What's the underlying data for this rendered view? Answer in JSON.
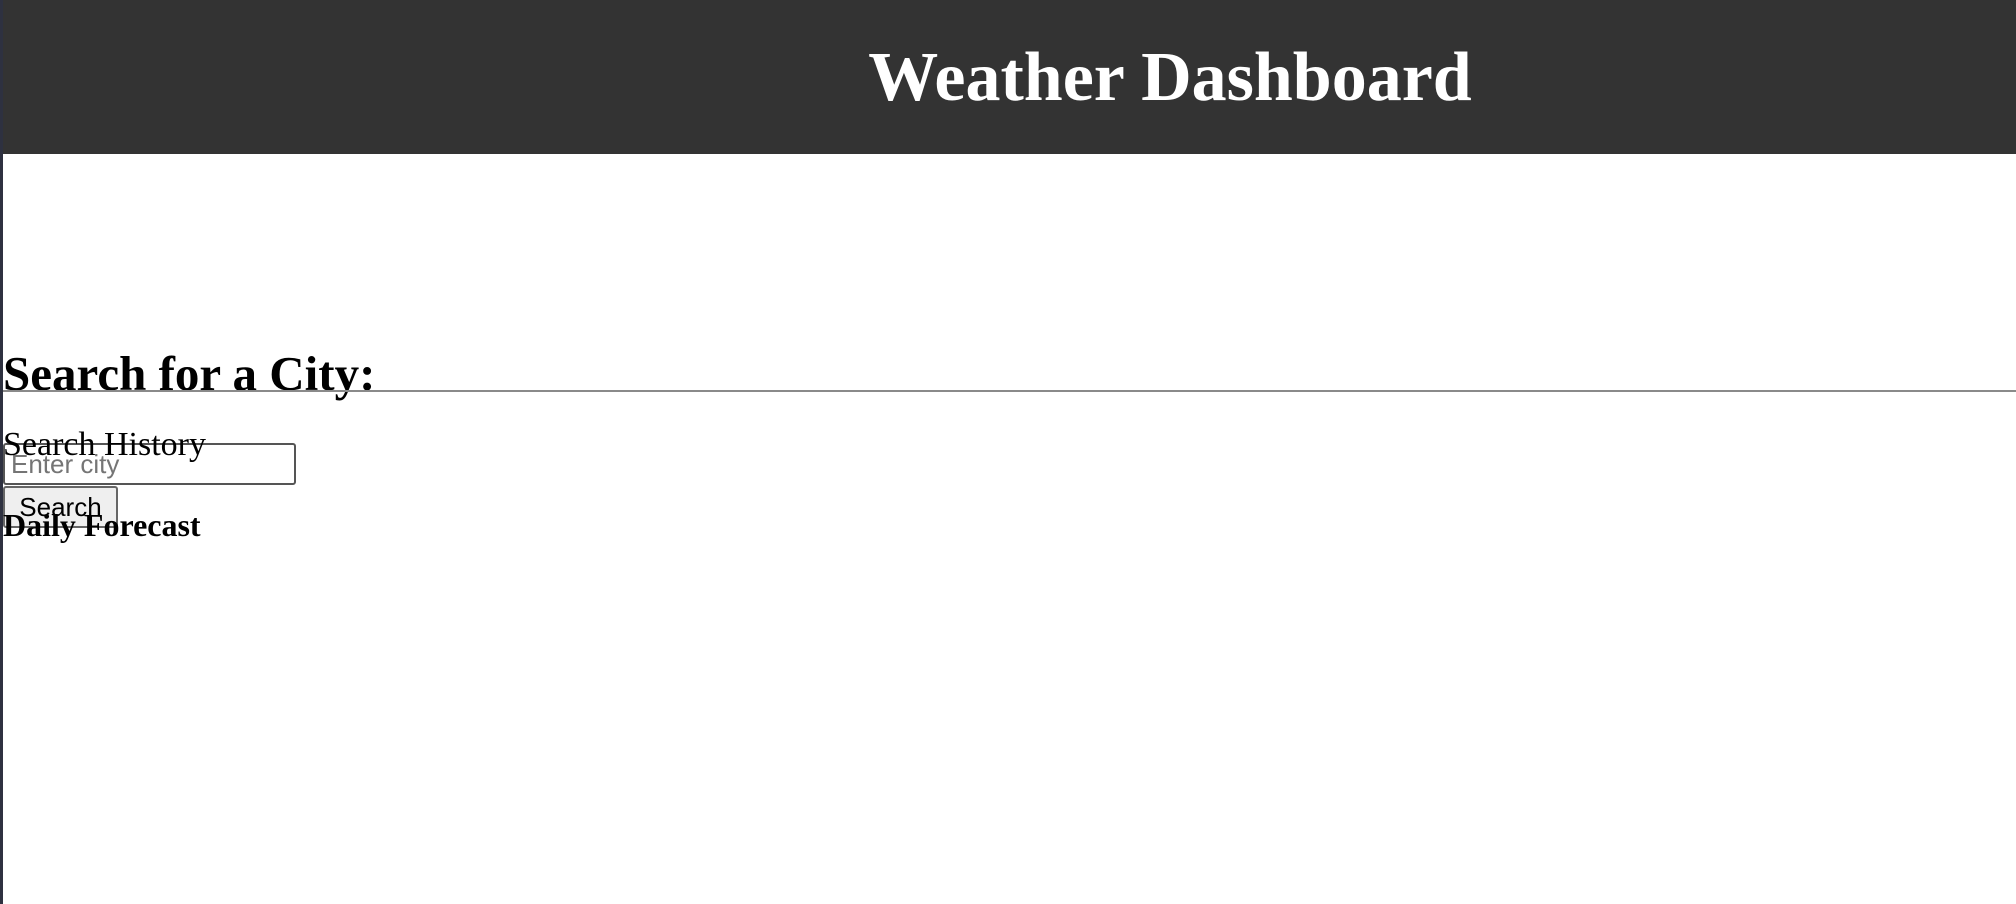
{
  "header": {
    "title": "Weather Dashboard"
  },
  "search": {
    "heading": "Search for a City:",
    "input_value": "",
    "placeholder": "Enter city",
    "button_label": "Search"
  },
  "history": {
    "label": "Search History",
    "items": []
  },
  "forecast": {
    "heading": "Daily Forecast"
  },
  "colors": {
    "header_background": "#333333",
    "header_text": "#ffffff",
    "page_background": "#ffffff",
    "divider": "#8a8a8a"
  }
}
